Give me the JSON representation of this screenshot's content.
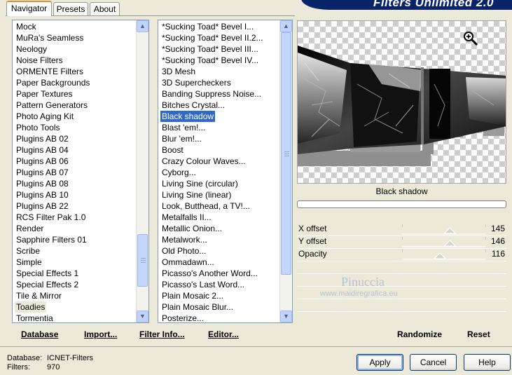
{
  "title": "Filters Unlimited 2.0",
  "tabs": [
    {
      "label": "Navigator",
      "active": true
    },
    {
      "label": "Presets",
      "active": false
    },
    {
      "label": "About",
      "active": false
    }
  ],
  "categories": {
    "items": [
      "Mock",
      "MuRa's Seamless",
      "Neology",
      "Noise Filters",
      "ORMENTE Filters",
      "Paper Backgrounds",
      "Paper Textures",
      "Pattern Generators",
      "Photo Aging Kit",
      "Photo Tools",
      "Plugins AB 02",
      "Plugins AB 04",
      "Plugins AB 06",
      "Plugins AB 07",
      "Plugins AB 08",
      "Plugins AB 10",
      "Plugins AB 22",
      "RCS Filter Pak 1.0",
      "Render",
      "Sapphire Filters 01",
      "Scribe",
      "Simple",
      "Special Effects 1",
      "Special Effects 2",
      "Tile & Mirror",
      "Toadies",
      "Tormentia"
    ],
    "selected": "Toadies"
  },
  "filters": {
    "items": [
      "*Sucking Toad*  Bevel I...",
      "*Sucking Toad*  Bevel II.2...",
      "*Sucking Toad*  Bevel III...",
      "*Sucking Toad*  Bevel IV...",
      "3D Mesh",
      "3D Supercheckers",
      "Banding Suppress Noise...",
      "Bitches Crystal...",
      "Black shadow",
      "Blast 'em!...",
      "Blur 'em!...",
      "Boost",
      "Crazy Colour Waves...",
      "Cyborg...",
      "Living Sine (circular)",
      "Living Sine (linear)",
      "Look, Butthead, a TV!...",
      "Metalfalls II...",
      "Metallic Onion...",
      "Metalwork...",
      "Old Photo...",
      "Ommadawn...",
      "Picasso's Another Word...",
      "Picasso's Last Word...",
      "Plain Mosaic 2...",
      "Plain Mosaic Blur...",
      "Posterize..."
    ],
    "selected": "Black shadow"
  },
  "preview": {
    "filter_name": "Black shadow",
    "zoom_icon": "zoom-in-icon"
  },
  "params": [
    {
      "label": "X offset",
      "value": "145",
      "level": 0.57
    },
    {
      "label": "Y offset",
      "value": "146",
      "level": 0.57
    },
    {
      "label": "Opacity",
      "value": "116",
      "level": 0.45
    }
  ],
  "watermark": {
    "name": "Pinuccia",
    "site": "www.maidiregrafica.eu"
  },
  "links": {
    "database": "Database",
    "import": "Import...",
    "filter_info": "Filter Info...",
    "editor": "Editor...",
    "randomize": "Randomize",
    "reset": "Reset"
  },
  "status": {
    "database_label": "Database:",
    "database_value": "ICNET-Filters",
    "filters_label": "Filters:",
    "filters_value": "970"
  },
  "buttons": {
    "apply": "Apply",
    "cancel": "Cancel",
    "help": "Help"
  }
}
